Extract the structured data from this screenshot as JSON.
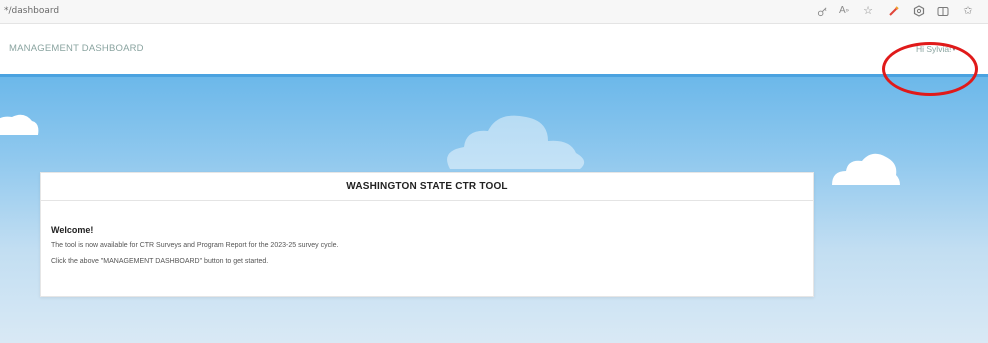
{
  "browser": {
    "url": "*/dashboard",
    "icons": [
      "key-icon",
      "read-aloud-icon",
      "favorite-star-icon",
      "extension-icon",
      "extensions-icon",
      "split-screen-icon",
      "favorites-icon"
    ]
  },
  "header": {
    "nav_title": "MANAGEMENT DASHBOARD",
    "user_greeting": "Hi Sylvia!",
    "caret": "▾"
  },
  "panel": {
    "title": "WASHINGTON STATE CTR TOOL",
    "heading": "Welcome!",
    "lines": [
      "The tool is now available for CTR Surveys and Program Report for the 2023-25 survey cycle.",
      "Click the above \"MANAGEMENT DASHBOARD\" button to get started."
    ]
  },
  "colors": {
    "nav_text": "#8aa4a0",
    "sky_top": "#6cb8ea",
    "sky_bottom": "#d9e9f5",
    "annotation": "#e01a1a"
  }
}
